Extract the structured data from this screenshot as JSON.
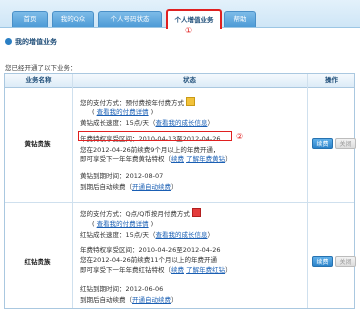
{
  "tabs": [
    {
      "label": "首页"
    },
    {
      "label": "我的Q众"
    },
    {
      "label": "个人号码状态"
    },
    {
      "label": "个人增值业务"
    },
    {
      "label": "帮助"
    }
  ],
  "markers": {
    "one": "①",
    "two": "②"
  },
  "section_title": "我的增值业务",
  "intro_text": "您已经开通了以下业务：",
  "table": {
    "headers": [
      "业务名称",
      "状态",
      "操作"
    ],
    "rows": [
      {
        "name": "黄钻贵族",
        "pay_prefix": "您的支付方式：",
        "pay_method": "预付费按年付费方式",
        "pay_icon": "gold-coin-icon",
        "pay_detail_link": "查看我的付费详情",
        "growth_prefix": "黄钻成长速度：",
        "growth_speed": "15点/天（",
        "growth_link": "查看我的成长信息",
        "growth_suffix": "）",
        "annual_period": "年费特权享受区间：2010-04-13至2012-04-26",
        "renew_text_1": "您在2012-04-26前续费9个月以上的年费开通，",
        "renew_text_2": "即可享受下一年年费黄钻特权（",
        "renew_link": "续费",
        "renew_more_link": "了解年费黄钻",
        "renew_close": "）",
        "expire_label": "黄钻到期时间：2012-08-07",
        "auto_renew_prefix": "到期后自动续费（",
        "auto_renew_link": "开通自动续费",
        "auto_renew_suffix": "）",
        "btn_renew": "续费",
        "btn_close": "关闭"
      },
      {
        "name": "红钻贵族",
        "pay_prefix": "您的支付方式：",
        "pay_method": "Q点/Q币按月付费方式",
        "pay_icon": "red-coin-icon",
        "pay_detail_link": "查看我的付费详情",
        "growth_prefix": "红钻成长速度：",
        "growth_speed": "15点/天（",
        "growth_link": "查看我的成长信息",
        "growth_suffix": "）",
        "annual_period": "年费特权享受区间：2010-04-26至2012-04-26",
        "renew_text_1": "您在2012-04-26前续费11个月以上的年费开通",
        "renew_text_2": "即可享受下一年年费红钻特权（",
        "renew_link": "续费",
        "renew_more_link": "了解年费红钻",
        "renew_close": "）",
        "expire_label": "红钻到期时间：2012-06-06",
        "auto_renew_prefix": "到期后自动续费（",
        "auto_renew_link": "开通自动续费",
        "auto_renew_suffix": "）",
        "btn_renew": "续费",
        "btn_close": "关闭"
      }
    ]
  }
}
